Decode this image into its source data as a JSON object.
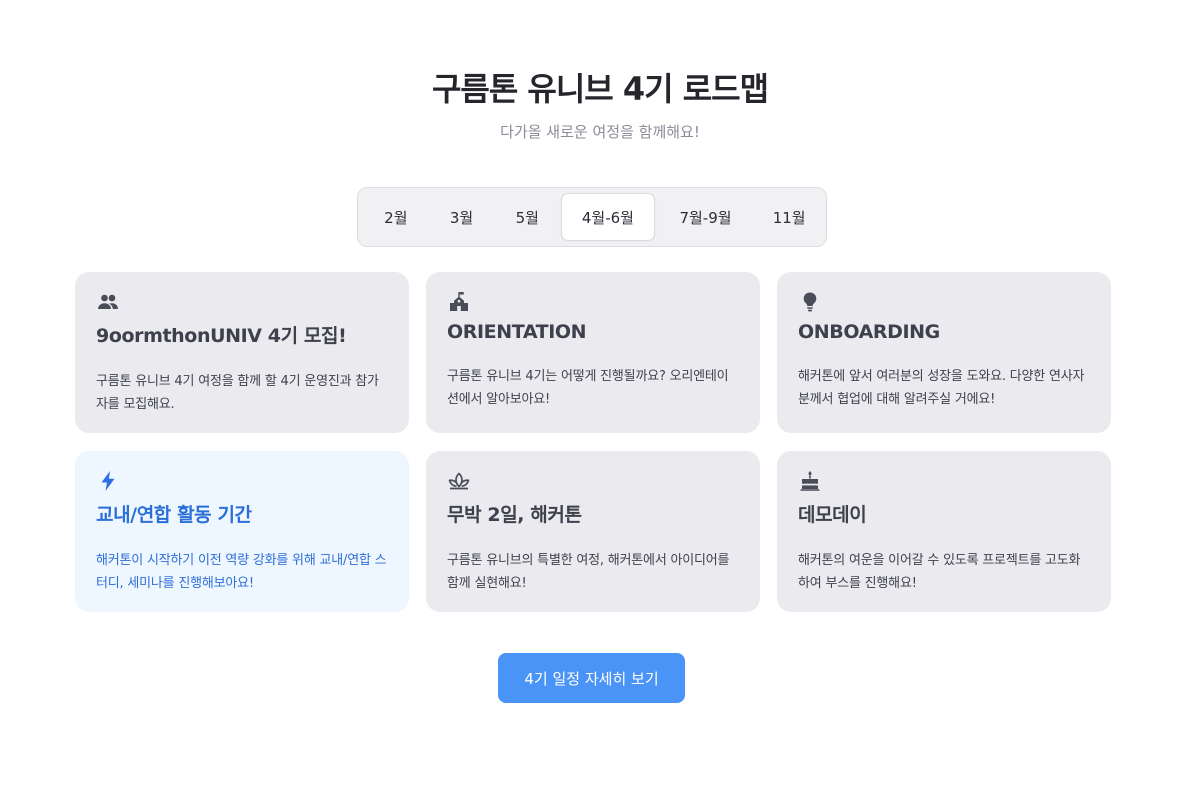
{
  "header": {
    "title": "구름톤 유니브 4기 로드맵",
    "subtitle": "다가올 새로운 여정을 함께해요!"
  },
  "tabs": [
    {
      "label": "2월",
      "active": false
    },
    {
      "label": "3월",
      "active": false
    },
    {
      "label": "5월",
      "active": false
    },
    {
      "label": "4월-6월",
      "active": true
    },
    {
      "label": "7월-9월",
      "active": false
    },
    {
      "label": "11월",
      "active": false
    }
  ],
  "cards": [
    {
      "icon": "people-icon",
      "title": "9oormthonUNIV 4기 모집!",
      "desc": "구름톤 유니브 4기 여정을 함께 할 4기 운영진과 참가자를 모집해요."
    },
    {
      "icon": "school-icon",
      "title": "ORIENTATION",
      "desc": "구름톤 유니브 4기는 어떻게 진행될까요? 오리엔테이션에서 알아보아요!"
    },
    {
      "icon": "lightbulb-icon",
      "title": "ONBOARDING",
      "desc": "해커톤에 앞서 여러분의 성장을 도와요. 다양한 연사자분께서 협업에 대해 알려주실 거에요!"
    },
    {
      "icon": "lightning-icon",
      "title": "교내/연합 활동 기간",
      "desc": "해커톤이 시작하기 이전 역량 강화를 위해 교내/연합 스터디, 세미나를 진행해보아요!",
      "highlight": true
    },
    {
      "icon": "lotus-icon",
      "title": "무박 2일, 해커톤",
      "desc": "구름톤 유니브의 특별한 여정, 해커톤에서 아이디어를 함께 실현해요!"
    },
    {
      "icon": "cake-icon",
      "title": "데모데이",
      "desc": "해커톤의 여운을 이어갈 수 있도록 프로젝트를 고도화하여 부스를 진행해요!"
    }
  ],
  "cta": {
    "label": "4기 일정 자세히 보기"
  },
  "colors": {
    "accent": "#4b94f7",
    "highlight_bg": "#eef6ff",
    "highlight_text": "#2b6fd8",
    "card_bg": "#eaeaef"
  }
}
